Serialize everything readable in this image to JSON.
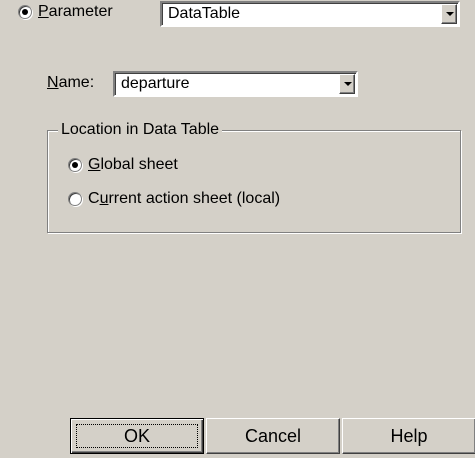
{
  "parameter": {
    "radio_label": "Parameter",
    "radio_mnemonic": "P",
    "radio_rest": "arameter",
    "type_value": "DataTable"
  },
  "name": {
    "label_mnemonic": "N",
    "label_rest": "ame:",
    "label": "Name:",
    "value": "departure"
  },
  "location": {
    "group_title": "Location in Data Table",
    "options": [
      {
        "label": "Global sheet",
        "mnemonic": "G",
        "rest": "lobal sheet",
        "selected": true
      },
      {
        "label": "Current action sheet (local)",
        "pre": "C",
        "mnemonic": "u",
        "rest": "rrent action sheet (local)",
        "selected": false
      }
    ]
  },
  "buttons": {
    "ok": "OK",
    "cancel": "Cancel",
    "help": "Help"
  }
}
